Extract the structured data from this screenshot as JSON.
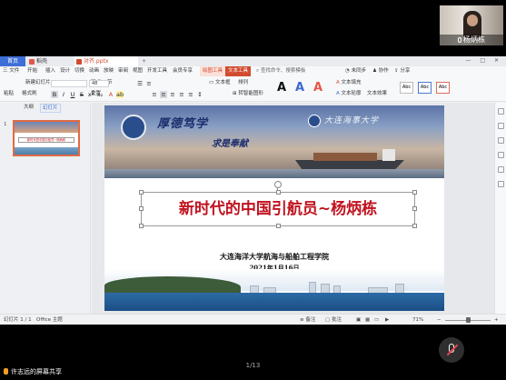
{
  "participant": {
    "name": "杨炳栋"
  },
  "wps": {
    "tabs": {
      "home": "首页",
      "template": "稻壳",
      "file": "对齐.pptx",
      "add": "+"
    },
    "window_controls": "— □ ✕",
    "menus": [
      "三 文件",
      "开始",
      "插入",
      "设计",
      "切换",
      "动画",
      "放映",
      "审阅",
      "视图",
      "开发工具",
      "会员专享",
      "绘图工具",
      "文本工具"
    ],
    "menu_right": {
      "search": "查找命令、搜索模板",
      "share": "分享",
      "collab": "协作",
      "unsync": "未同步"
    },
    "toolbar": {
      "new_slide": "新建幻灯片",
      "layout": "版式",
      "section": "节",
      "reset": "重置",
      "font_size": "48",
      "text_box": "文本框",
      "arrange": "排列",
      "smartart": "转智能图形",
      "text_fill": "文本填充",
      "text_outline": "文本轮廓",
      "text_effect": "文本效果",
      "swatch_label": "Abc",
      "format_painter": "格式刷",
      "paste": "粘贴"
    },
    "left_panel": {
      "tab1": "大纲",
      "tab2": "幻灯片",
      "slide_number": "1"
    },
    "slide": {
      "motto_left": "厚德笃学",
      "motto_mid": "求是奉献",
      "motto_right": "大连海事大学",
      "title": "新时代的中国引航员~杨炳栋",
      "subtitle": "大连海洋大学航海与船舶工程学院",
      "date": "2021年1月16日"
    },
    "status": {
      "slide_count": "幻灯片 1 / 1",
      "theme": "Office 主题",
      "notes": "备注",
      "comment": "批注",
      "zoom": "71%"
    }
  },
  "meeting": {
    "page_indicator": "1/13",
    "share_label": "许志远的屏幕共享"
  }
}
